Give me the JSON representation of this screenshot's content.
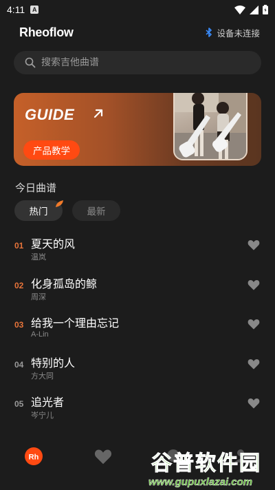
{
  "status_bar": {
    "time": "4:11",
    "notification_letter": "A"
  },
  "header": {
    "logo": "Rheoflow",
    "bluetooth_status": "设备未连接"
  },
  "search": {
    "placeholder": "搜索吉他曲谱"
  },
  "banner": {
    "title": "GUIDE",
    "button_label": "产品教学"
  },
  "section": {
    "title": "今日曲谱"
  },
  "tabs": [
    {
      "label": "热门",
      "active": true
    },
    {
      "label": "最新",
      "active": false
    }
  ],
  "songs": [
    {
      "num": "01",
      "title": "夏天的风",
      "artist": "温岚",
      "num_color": "#e8743a"
    },
    {
      "num": "02",
      "title": "化身孤岛的鲸",
      "artist": "周深",
      "num_color": "#e8743a"
    },
    {
      "num": "03",
      "title": "给我一个理由忘记",
      "artist": "A-Lin",
      "num_color": "#e8743a"
    },
    {
      "num": "04",
      "title": "特别的人",
      "artist": "方大同",
      "num_color": "#9a9a9a"
    },
    {
      "num": "05",
      "title": "追光者",
      "artist": "岑宁儿",
      "num_color": "#9a9a9a"
    }
  ],
  "bottom_nav": {
    "home_logo": "Rh"
  },
  "watermark": {
    "title": "谷普软件园",
    "url": "www.gupuxlazai.com"
  },
  "colors": {
    "accent": "#ff4a12",
    "bg": "#1c1c1c",
    "watermark": "#59b62c"
  }
}
